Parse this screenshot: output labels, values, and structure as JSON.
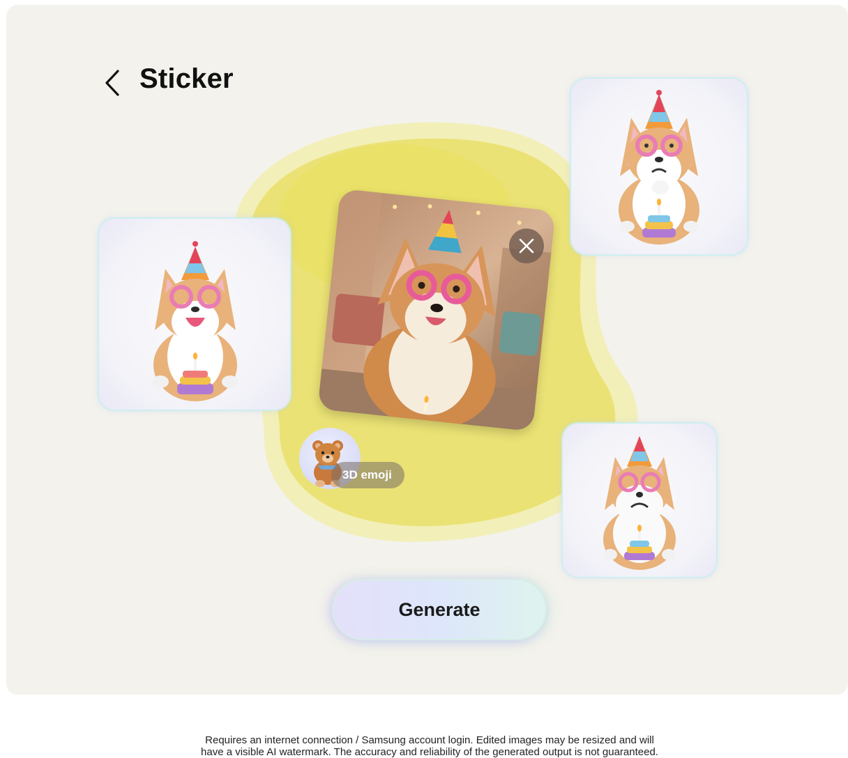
{
  "header": {
    "back_icon": "chevron-left-icon",
    "title": "Sticker"
  },
  "main_photo": {
    "subject": "corgi-party-photo",
    "close_icon": "close-icon"
  },
  "stickers": [
    {
      "name": "sticker-laughing-corgi"
    },
    {
      "name": "sticker-thinking-corgi"
    },
    {
      "name": "sticker-crying-corgi"
    }
  ],
  "style_chip": {
    "label": "3D emoji",
    "icon": "teddy-bear-icon"
  },
  "actions": {
    "generate_label": "Generate"
  },
  "footer": {
    "line1": "Requires an internet connection / Samsung account login. Edited images may be resized and will",
    "line2": "have a visible AI watermark. The accuracy and reliability of the generated output is not guaranteed."
  },
  "colors": {
    "panel_bg": "#f3f2ec",
    "blob_outer": "#f2efb5",
    "blob_inner": "#e8e068",
    "text": "#111111"
  }
}
